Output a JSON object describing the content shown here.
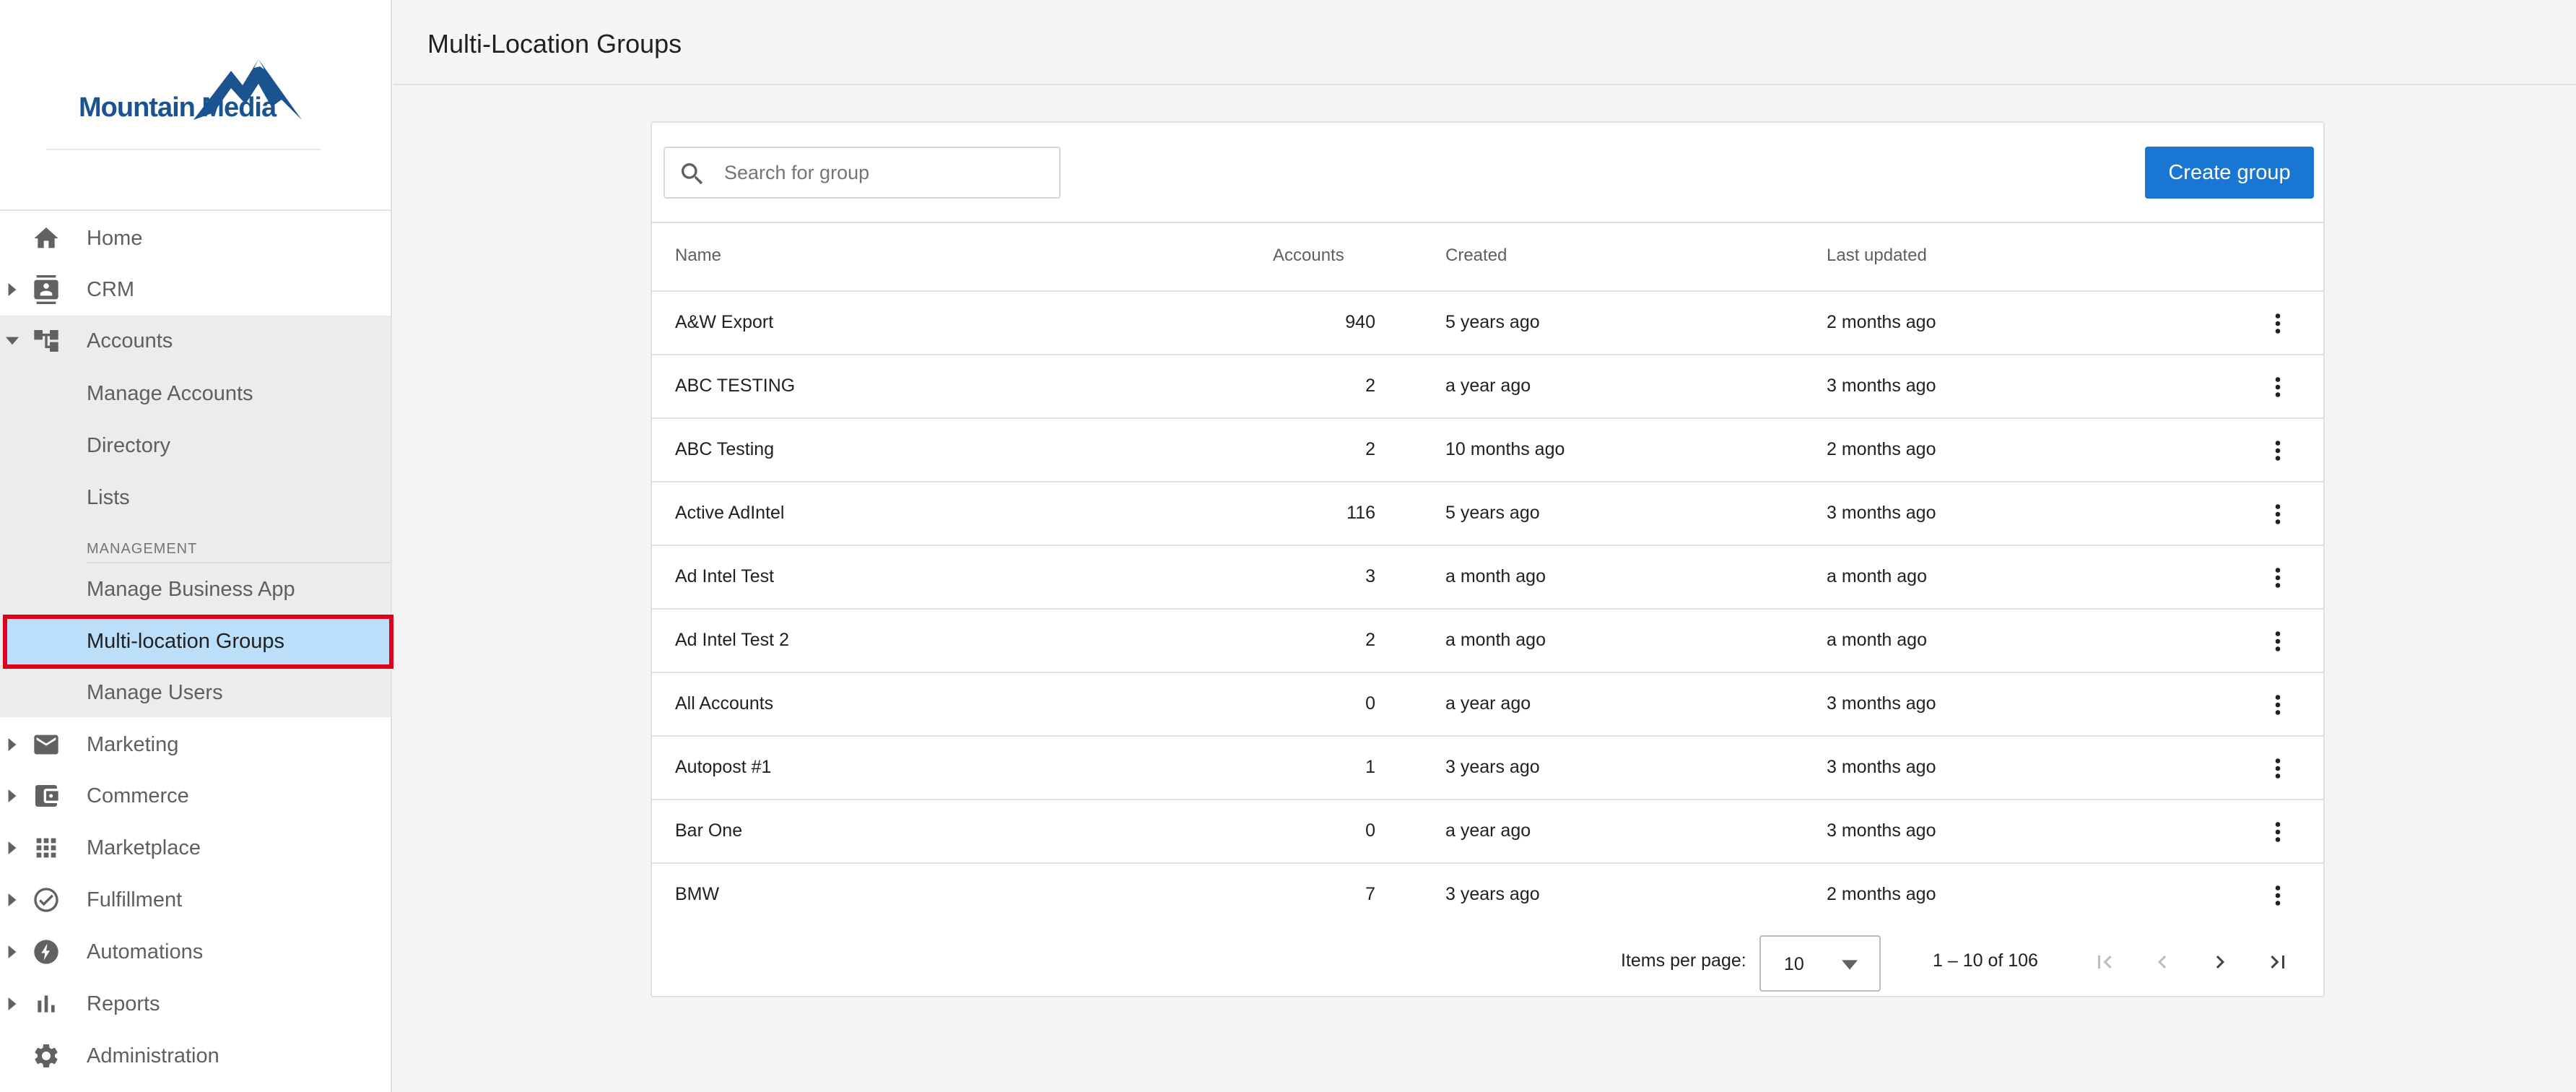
{
  "brand": {
    "name": "Mountain Media"
  },
  "colors": {
    "accent": "#1976d2",
    "active_bg": "#bbdefb",
    "highlight_border": "#e0001b"
  },
  "sidebar": {
    "items": [
      {
        "label": "Home",
        "icon": "home-icon",
        "expandable": false
      },
      {
        "label": "CRM",
        "icon": "contact-card-icon",
        "expandable": true,
        "expanded": false
      },
      {
        "label": "Accounts",
        "icon": "hierarchy-icon",
        "expandable": true,
        "expanded": true
      },
      {
        "label": "Marketing",
        "icon": "mail-icon",
        "expandable": true,
        "expanded": false
      },
      {
        "label": "Commerce",
        "icon": "wallet-icon",
        "expandable": true,
        "expanded": false
      },
      {
        "label": "Marketplace",
        "icon": "grid-icon",
        "expandable": true,
        "expanded": false
      },
      {
        "label": "Fulfillment",
        "icon": "check-circle-icon",
        "expandable": true,
        "expanded": false
      },
      {
        "label": "Automations",
        "icon": "bolt-icon",
        "expandable": true,
        "expanded": false
      },
      {
        "label": "Reports",
        "icon": "bar-chart-icon",
        "expandable": true,
        "expanded": false
      },
      {
        "label": "Administration",
        "icon": "gear-icon",
        "expandable": false
      }
    ],
    "accounts_sub": [
      "Manage Accounts",
      "Directory",
      "Lists"
    ],
    "management_label": "MANAGEMENT",
    "management_sub": [
      "Manage Business App",
      "Multi-location Groups",
      "Manage Users"
    ],
    "active_item": "Multi-location Groups"
  },
  "header": {
    "title": "Multi-Location Groups"
  },
  "toolbar": {
    "search_placeholder": "Search for group",
    "search_value": "",
    "create_label": "Create group"
  },
  "table": {
    "columns": {
      "name": "Name",
      "accounts": "Accounts",
      "created": "Created",
      "updated": "Last updated"
    },
    "rows": [
      {
        "name": "A&W Export",
        "accounts": "940",
        "created": "5 years ago",
        "updated": "2 months ago"
      },
      {
        "name": "ABC TESTING",
        "accounts": "2",
        "created": "a year ago",
        "updated": "3 months ago"
      },
      {
        "name": "ABC Testing",
        "accounts": "2",
        "created": "10 months ago",
        "updated": "2 months ago"
      },
      {
        "name": "Active AdIntel",
        "accounts": "116",
        "created": "5 years ago",
        "updated": "3 months ago"
      },
      {
        "name": "Ad Intel Test",
        "accounts": "3",
        "created": "a month ago",
        "updated": "a month ago"
      },
      {
        "name": "Ad Intel Test 2",
        "accounts": "2",
        "created": "a month ago",
        "updated": "a month ago"
      },
      {
        "name": "All Accounts",
        "accounts": "0",
        "created": "a year ago",
        "updated": "3 months ago"
      },
      {
        "name": "Autopost #1",
        "accounts": "1",
        "created": "3 years ago",
        "updated": "3 months ago"
      },
      {
        "name": "Bar One",
        "accounts": "0",
        "created": "a year ago",
        "updated": "3 months ago"
      },
      {
        "name": "BMW",
        "accounts": "7",
        "created": "3 years ago",
        "updated": "2 months ago"
      }
    ]
  },
  "pagination": {
    "items_per_page_label": "Items per page:",
    "items_per_page": "10",
    "range": "1 – 10 of 106"
  }
}
